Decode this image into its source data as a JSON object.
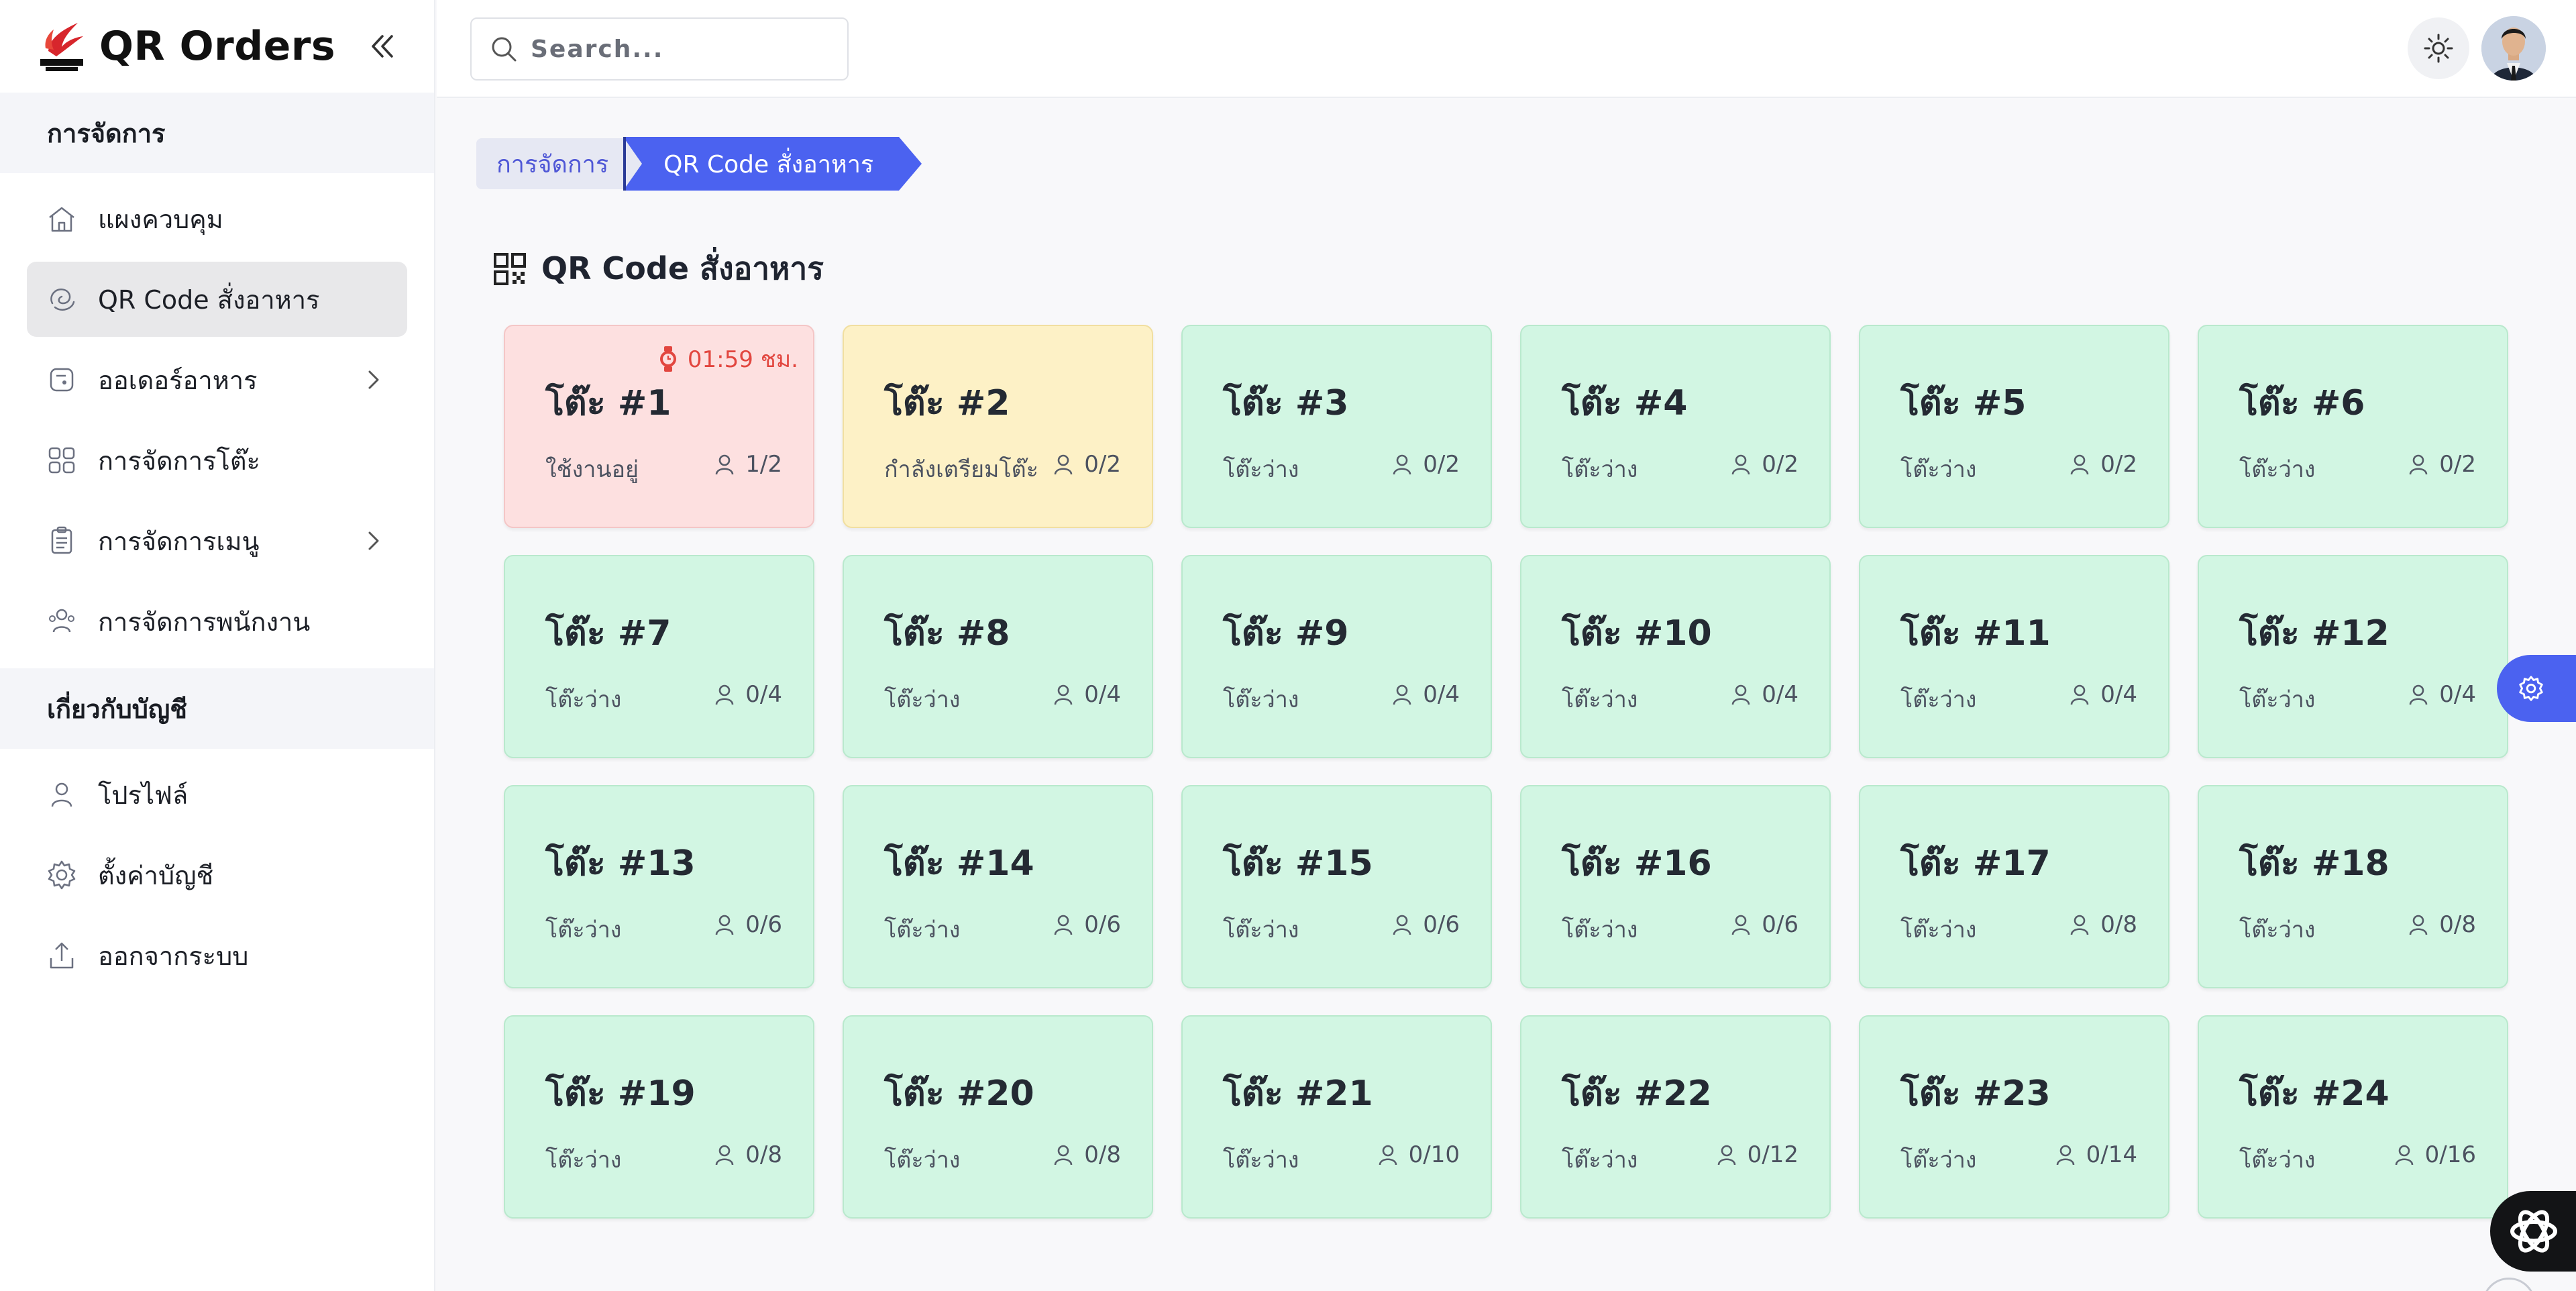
{
  "app": {
    "title": "QR Orders",
    "logo_text": "THE ICON"
  },
  "sidebar": {
    "sections": [
      {
        "heading": "การจัดการ",
        "items": [
          {
            "label": "แผงควบคุม",
            "icon": "house-icon",
            "active": false,
            "has_children": false
          },
          {
            "label": "QR Code สั่งอาหาร",
            "icon": "qr-swirl-icon",
            "active": true,
            "has_children": false
          },
          {
            "label": "ออเดอร์อาหาร",
            "icon": "order-icon",
            "active": false,
            "has_children": true
          },
          {
            "label": "การจัดการโต๊ะ",
            "icon": "grid-icon",
            "active": false,
            "has_children": false
          },
          {
            "label": "การจัดการเมนู",
            "icon": "clipboard-icon",
            "active": false,
            "has_children": true
          },
          {
            "label": "การจัดการพนักงาน",
            "icon": "users-icon",
            "active": false,
            "has_children": false
          }
        ]
      },
      {
        "heading": "เกี่ยวกับบัญชี",
        "items": [
          {
            "label": "โปรไฟล์",
            "icon": "user-icon",
            "active": false,
            "has_children": false
          },
          {
            "label": "ตั้งค่าบัญชี",
            "icon": "gear-icon",
            "active": false,
            "has_children": false
          },
          {
            "label": "ออกจากระบบ",
            "icon": "logout-icon",
            "active": false,
            "has_children": false
          }
        ]
      }
    ]
  },
  "topbar": {
    "search_placeholder": "Search..."
  },
  "breadcrumb": {
    "items": [
      "การจัดการ",
      "QR Code สั่งอาหาร"
    ]
  },
  "page": {
    "title": "QR Code สั่งอาหาร"
  },
  "colors": {
    "accent": "#4b62f0",
    "available": "#d2f6e3",
    "busy": "#fde0e0",
    "preparing": "#fdf1c6",
    "timer": "#e2463f"
  },
  "tables": [
    {
      "name": "โต๊ะ #1",
      "status": "ใช้งานอยู่",
      "capacity": "1/2",
      "state": "busy",
      "timer": "01:59 ชม."
    },
    {
      "name": "โต๊ะ #2",
      "status": "กำลังเตรียมโต๊ะ",
      "capacity": "0/2",
      "state": "prep"
    },
    {
      "name": "โต๊ะ #3",
      "status": "โต๊ะว่าง",
      "capacity": "0/2",
      "state": "free"
    },
    {
      "name": "โต๊ะ #4",
      "status": "โต๊ะว่าง",
      "capacity": "0/2",
      "state": "free"
    },
    {
      "name": "โต๊ะ #5",
      "status": "โต๊ะว่าง",
      "capacity": "0/2",
      "state": "free"
    },
    {
      "name": "โต๊ะ #6",
      "status": "โต๊ะว่าง",
      "capacity": "0/2",
      "state": "free"
    },
    {
      "name": "โต๊ะ #7",
      "status": "โต๊ะว่าง",
      "capacity": "0/4",
      "state": "free"
    },
    {
      "name": "โต๊ะ #8",
      "status": "โต๊ะว่าง",
      "capacity": "0/4",
      "state": "free"
    },
    {
      "name": "โต๊ะ #9",
      "status": "โต๊ะว่าง",
      "capacity": "0/4",
      "state": "free"
    },
    {
      "name": "โต๊ะ #10",
      "status": "โต๊ะว่าง",
      "capacity": "0/4",
      "state": "free"
    },
    {
      "name": "โต๊ะ #11",
      "status": "โต๊ะว่าง",
      "capacity": "0/4",
      "state": "free"
    },
    {
      "name": "โต๊ะ #12",
      "status": "โต๊ะว่าง",
      "capacity": "0/4",
      "state": "free"
    },
    {
      "name": "โต๊ะ #13",
      "status": "โต๊ะว่าง",
      "capacity": "0/6",
      "state": "free"
    },
    {
      "name": "โต๊ะ #14",
      "status": "โต๊ะว่าง",
      "capacity": "0/6",
      "state": "free"
    },
    {
      "name": "โต๊ะ #15",
      "status": "โต๊ะว่าง",
      "capacity": "0/6",
      "state": "free"
    },
    {
      "name": "โต๊ะ #16",
      "status": "โต๊ะว่าง",
      "capacity": "0/6",
      "state": "free"
    },
    {
      "name": "โต๊ะ #17",
      "status": "โต๊ะว่าง",
      "capacity": "0/8",
      "state": "free"
    },
    {
      "name": "โต๊ะ #18",
      "status": "โต๊ะว่าง",
      "capacity": "0/8",
      "state": "free"
    },
    {
      "name": "โต๊ะ #19",
      "status": "โต๊ะว่าง",
      "capacity": "0/8",
      "state": "free"
    },
    {
      "name": "โต๊ะ #20",
      "status": "โต๊ะว่าง",
      "capacity": "0/8",
      "state": "free"
    },
    {
      "name": "โต๊ะ #21",
      "status": "โต๊ะว่าง",
      "capacity": "0/10",
      "state": "free"
    },
    {
      "name": "โต๊ะ #22",
      "status": "โต๊ะว่าง",
      "capacity": "0/12",
      "state": "free"
    },
    {
      "name": "โต๊ะ #23",
      "status": "โต๊ะว่าง",
      "capacity": "0/14",
      "state": "free"
    },
    {
      "name": "โต๊ะ #24",
      "status": "โต๊ะว่าง",
      "capacity": "0/16",
      "state": "free"
    }
  ]
}
